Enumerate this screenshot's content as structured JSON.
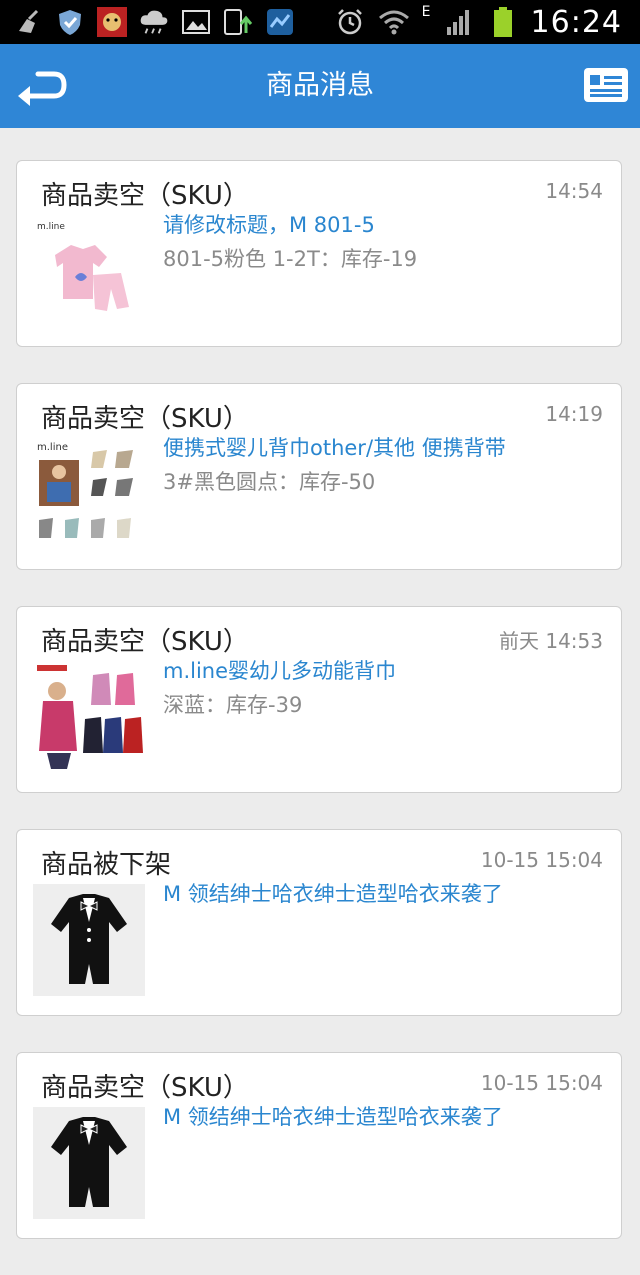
{
  "status_bar": {
    "time": "16:24",
    "network": "E"
  },
  "header": {
    "title": "商品消息"
  },
  "messages": [
    {
      "title": "商品卖空（SKU）",
      "time": "14:54",
      "product": "请修改标题，M 801-5",
      "detail": "801-5粉色 1-2T：库存-19",
      "thumb_icon": "pink-baby-outfit-thumbnail",
      "thumb_text": "m.line"
    },
    {
      "title": "商品卖空（SKU）",
      "time": "14:19",
      "product": "便携式婴儿背巾other/其他 便携背带",
      "detail": "3#黑色圆点：库存-50",
      "thumb_icon": "baby-sling-thumbnail",
      "thumb_text": "m.line"
    },
    {
      "title": "商品卖空（SKU）",
      "time": "前天 14:53",
      "product": "m.line婴幼儿多动能背巾",
      "detail": "深蓝：库存-39",
      "thumb_icon": "baby-carrier-thumbnail",
      "thumb_text": ""
    },
    {
      "title": "商品被下架",
      "time": "10-15 15:04",
      "product": "M 领结绅士哈衣绅士造型哈衣来袭了",
      "detail": "",
      "thumb_icon": "tuxedo-romper-thumbnail",
      "thumb_text": ""
    },
    {
      "title": "商品卖空（SKU）",
      "time": "10-15 15:04",
      "product": "M 领结绅士哈衣绅士造型哈衣来袭了",
      "detail": "",
      "thumb_icon": "tuxedo-romper-thumbnail",
      "thumb_text": ""
    }
  ],
  "colors": {
    "header_bg": "#2f86d6",
    "link": "#2a86cf",
    "muted": "#8a8a8a"
  }
}
